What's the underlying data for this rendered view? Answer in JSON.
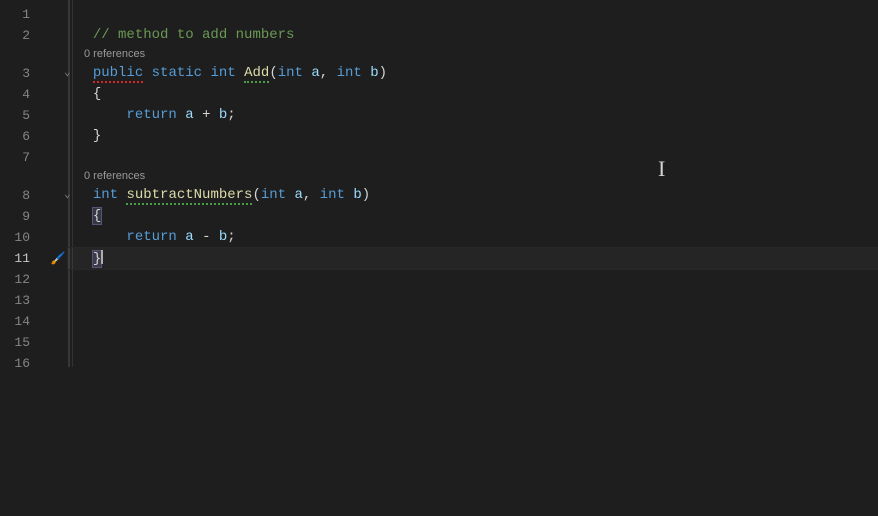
{
  "gutter": {
    "lines": [
      "1",
      "2",
      "3",
      "4",
      "5",
      "6",
      "7",
      "8",
      "9",
      "10",
      "11",
      "12",
      "13",
      "14",
      "15",
      "16"
    ],
    "active_line": "11"
  },
  "codelens": {
    "refs1": "0 references",
    "refs2": "0 references"
  },
  "code": {
    "l1": "",
    "l2_comment": "// method to add numbers",
    "l3_public": "public",
    "l3_static": "static",
    "l3_int": "int",
    "l3_add": "Add",
    "l3_lp": "(",
    "l3_int2": "int",
    "l3_a": "a",
    "l3_c1": ",",
    "l3_int3": "int",
    "l3_b": "b",
    "l3_rp": ")",
    "l4_brace": "{",
    "l5_return": "return",
    "l5_a": "a",
    "l5_plus": "+",
    "l5_b": "b",
    "l5_semi": ";",
    "l6_brace": "}",
    "l8_int": "int",
    "l8_name": "subtractNumbers",
    "l8_lp": "(",
    "l8_int2": "int",
    "l8_a": "a",
    "l8_c1": ",",
    "l8_int3": "int",
    "l8_b": "b",
    "l8_rp": ")",
    "l9_brace": "{",
    "l10_return": "return",
    "l10_a": "a",
    "l10_minus": "-",
    "l10_b": "b",
    "l10_semi": ";",
    "l11_brace": "}"
  }
}
